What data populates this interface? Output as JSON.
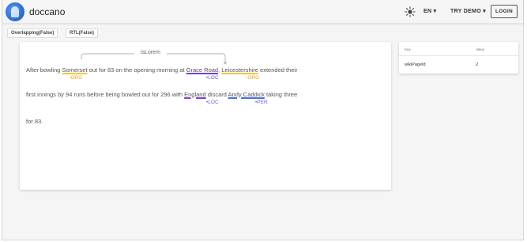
{
  "app": {
    "name": "doccano"
  },
  "header": {
    "language": "EN ▾",
    "try_demo": "TRY DEMO ▾",
    "login": "LOGIN"
  },
  "tabs": [
    {
      "label": "Overlapping(False)"
    },
    {
      "label": "RTL(False)"
    }
  ],
  "relation": {
    "label": "isLorem"
  },
  "text": {
    "l1_a": "After bowling ",
    "l1_e1": "Somerset",
    "l1_b": " out for 83 on the opening morning at ",
    "l1_e2": "Grace Road",
    "l1_c": ", ",
    "l1_e3": "Leicestershire",
    "l1_d": " extended their",
    "l2_a": "first innings by 94 runs before being bowled out for 296 with ",
    "l2_e1": "England",
    "l2_b": " discard ",
    "l2_e2": "Andy Caddick",
    "l2_c": " taking three",
    "l3": "for 83."
  },
  "labels": {
    "org1": "ORG",
    "loc1": "LOC",
    "org2": "ORG",
    "loc2": "LOC",
    "per": "PER"
  },
  "colors": {
    "org": "#f4c542",
    "loc": "#7b3fd0",
    "per": "#4c6fe0",
    "org_text": "#e0a400",
    "loc_text": "#6c63d8",
    "per_text": "#6c63d8"
  },
  "metadata_table": {
    "headers": {
      "key": "Key",
      "value": "Value"
    },
    "rows": [
      {
        "key": "wikiPageId",
        "value": "2"
      }
    ]
  },
  "icons": {
    "theme": "sun-icon",
    "logo": "doccano-logo-icon"
  }
}
